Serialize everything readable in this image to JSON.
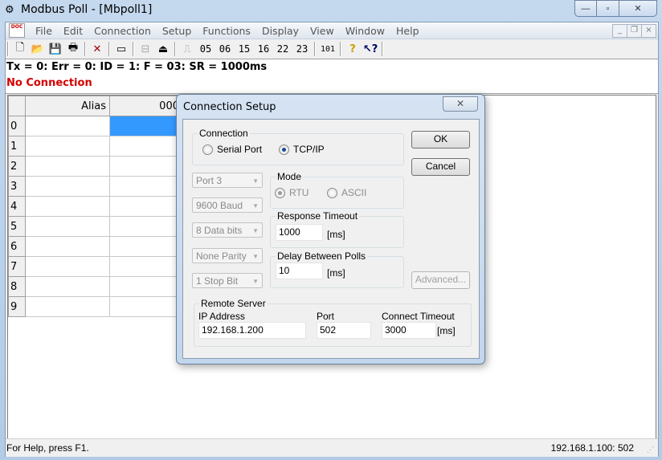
{
  "window": {
    "title": "Modbus Poll - [Mbpoll1]",
    "controls": {
      "minimize": "—",
      "maximize": "▫",
      "close": "✕"
    }
  },
  "menubar": {
    "items": [
      "File",
      "Edit",
      "Connection",
      "Setup",
      "Functions",
      "Display",
      "View",
      "Window",
      "Help"
    ],
    "mdi_controls": {
      "minimize": "_",
      "restore": "❐",
      "close": "×"
    }
  },
  "toolbar": {
    "function_codes": [
      "05",
      "06",
      "15",
      "16",
      "22",
      "23"
    ],
    "counter_label": "101"
  },
  "status_area": {
    "line1": "Tx = 0: Err = 0: ID = 1: F = 03: SR = 1000ms",
    "line2": "No Connection",
    "line2_color": "#d40000"
  },
  "grid": {
    "columns": [
      "Alias",
      "000"
    ],
    "rows": [
      "0",
      "1",
      "2",
      "3",
      "4",
      "5",
      "6",
      "7",
      "8",
      "9"
    ],
    "selected_row": 0
  },
  "statusbar": {
    "help": "For Help, press F1.",
    "address": "192.168.1.100: 502"
  },
  "dialog": {
    "title": "Connection Setup",
    "connection_group": "Connection",
    "serial_port": "Serial Port",
    "tcpip": "TCP/IP",
    "selected_connection": "TCP/IP",
    "serial": {
      "port": "Port 3",
      "baud": "9600 Baud",
      "data_bits": "8 Data bits",
      "parity": "None Parity",
      "stop_bits": "1 Stop Bit"
    },
    "mode_group": "Mode",
    "mode_rtu": "RTU",
    "mode_ascii": "ASCII",
    "selected_mode": "RTU",
    "response_timeout_label": "Response Timeout",
    "response_timeout": "1000",
    "delay_label": "Delay Between Polls",
    "delay": "10",
    "unit_ms": "[ms]",
    "ok": "OK",
    "cancel": "Cancel",
    "advanced": "Advanced...",
    "remote_server_group": "Remote Server",
    "ip_label": "IP Address",
    "ip": "192.168.1.200",
    "port_label": "Port",
    "port": "502",
    "connect_timeout_label": "Connect Timeout",
    "connect_timeout": "3000"
  }
}
